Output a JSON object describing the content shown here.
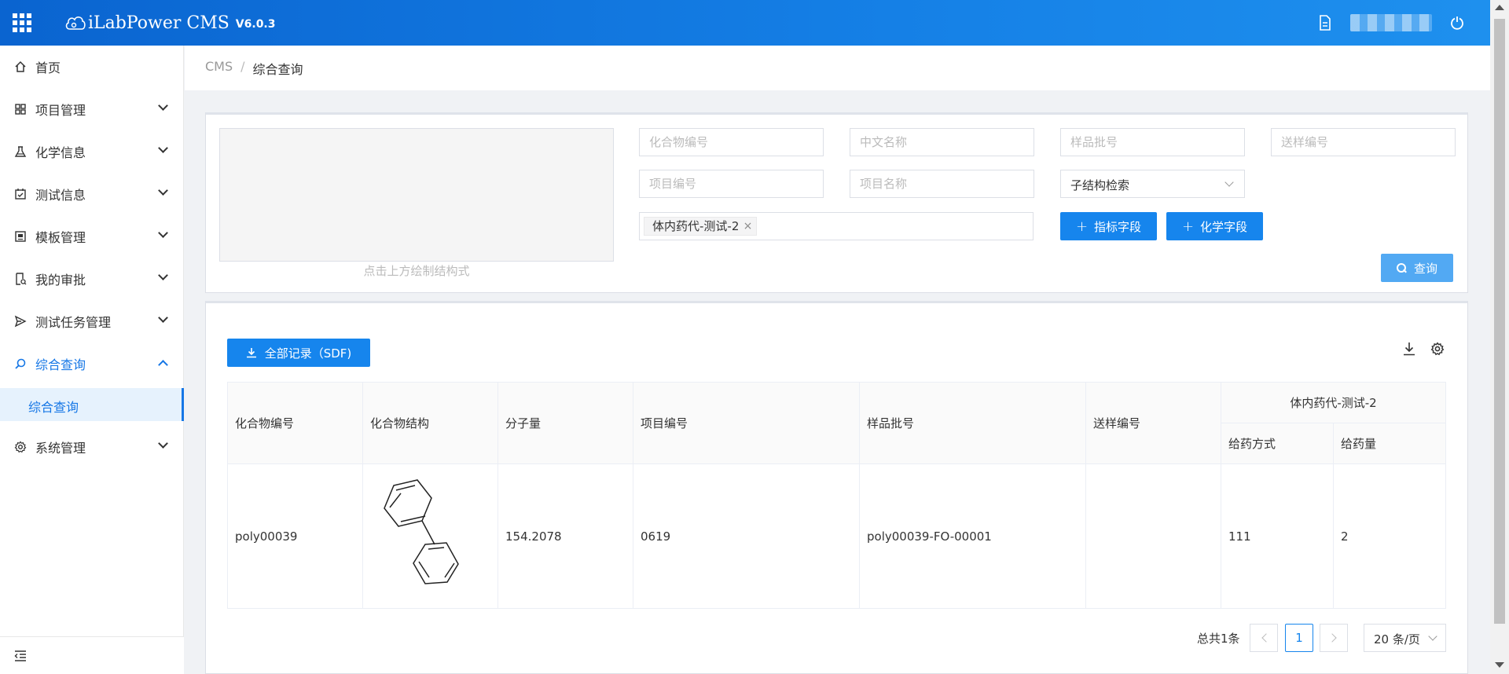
{
  "header": {
    "app_name": "iLabPower CMS",
    "version": "V6.0.3",
    "grid_icon": "grid-icon",
    "doc_icon": "document-icon",
    "logout_icon": "power-icon"
  },
  "sidebar": {
    "items": [
      {
        "label": "首页",
        "icon": "home-icon"
      },
      {
        "label": "项目管理",
        "icon": "apps-icon"
      },
      {
        "label": "化学信息",
        "icon": "flask-icon"
      },
      {
        "label": "测试信息",
        "icon": "calendar-check-icon"
      },
      {
        "label": "模板管理",
        "icon": "template-icon"
      },
      {
        "label": "我的审批",
        "icon": "approval-icon"
      },
      {
        "label": "测试任务管理",
        "icon": "send-icon"
      },
      {
        "label": "综合查询",
        "icon": "search-icon"
      },
      {
        "label": "系统管理",
        "icon": "gear-icon"
      }
    ],
    "active_sub": "综合查询"
  },
  "breadcrumb": {
    "root": "CMS",
    "sep": "/",
    "current": "综合查询"
  },
  "search": {
    "draw_hint": "点击上方绘制结构式",
    "compound_no_ph": "化合物编号",
    "cn_name_ph": "中文名称",
    "batch_no_ph": "样品批号",
    "sample_no_ph": "送样编号",
    "project_no_ph": "项目编号",
    "project_name_ph": "项目名称",
    "structure_mode": "子结构检索",
    "tag": "体内药代-测试-2",
    "indicator_btn": "指标字段",
    "chem_btn": "化学字段",
    "query_btn": "查询"
  },
  "results": {
    "export_btn": "全部记录（SDF)",
    "columns": [
      "化合物编号",
      "化合物结构",
      "分子量",
      "项目编号",
      "样品批号",
      "送样编号"
    ],
    "group_header": "体内药代-测试-2",
    "group_columns": [
      "给药方式",
      "给药量"
    ],
    "rows": [
      {
        "compound_no": "poly00039",
        "mw": "154.2078",
        "project_no": "0619",
        "batch_no": "poly00039-FO-00001",
        "sample_no": "",
        "route": "111",
        "dose": "2"
      }
    ]
  },
  "pagination": {
    "total": "总共1条",
    "current": "1",
    "page_size": "20 条/页"
  }
}
